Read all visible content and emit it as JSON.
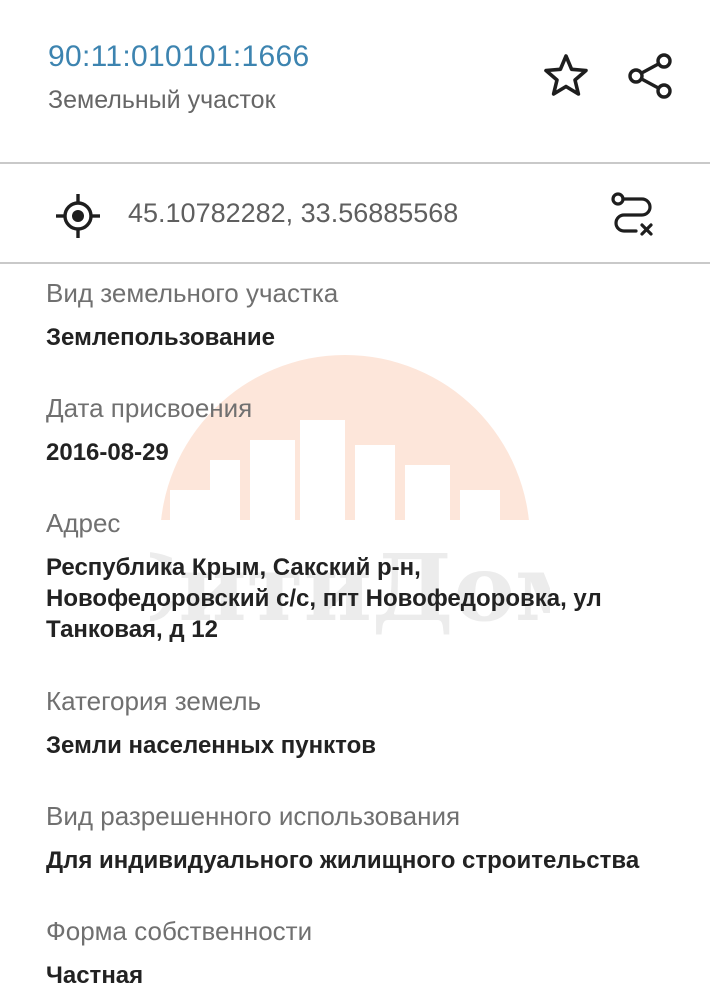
{
  "header": {
    "cadastral_number": "90:11:010101:1666",
    "object_type": "Земельный участок",
    "star_icon": "star-outline-icon",
    "share_icon": "share-icon"
  },
  "coords": {
    "locate_icon": "crosshair-icon",
    "value": "45.10782282, 33.56885568",
    "route_icon": "route-clear-icon"
  },
  "watermark": {
    "text": "СитиДом",
    "colors": [
      "#fde3d6",
      "#eeeeee"
    ]
  },
  "fields": [
    {
      "label": "Вид земельного участка",
      "value": "Землепользование"
    },
    {
      "label": "Дата присвоения",
      "value": "2016-08-29"
    },
    {
      "label": "Адрес",
      "value_lines": [
        "Республика Крым, Сакский р-н,",
        "Новофедоровский с/с, пгт Новофедоровка, ул",
        "Танковая, д 12"
      ]
    },
    {
      "label": "Категория земель",
      "value": "Земли населенных пунктов"
    },
    {
      "label": "Вид разрешенного использования",
      "value": "Для индивидуального жилищного строительства"
    },
    {
      "label": "Форма собственности",
      "value": "Частная"
    }
  ],
  "colors": {
    "accent": "#3d84b0",
    "label": "#707070",
    "value": "#222222",
    "divider": "#c9c9c9"
  }
}
